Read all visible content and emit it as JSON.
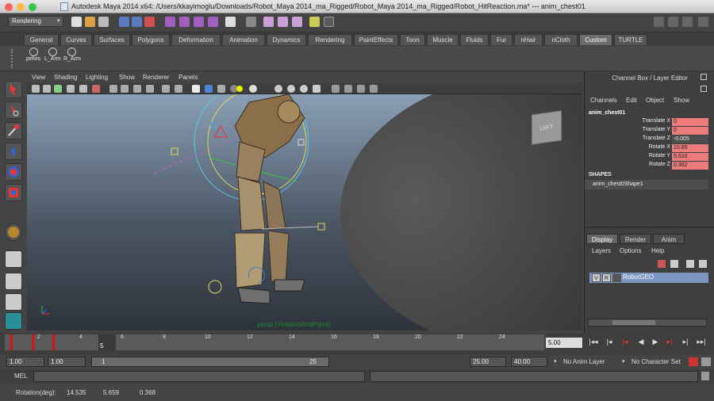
{
  "window": {
    "title": "Autodesk Maya 2014 x64: /Users/kkayimoglu/Downloads/Robot_Maya 2014_ma_Rigged/Robot_Maya 2014_ma_Rigged/Robot_HitReaction.ma*    ---    anim_chest01"
  },
  "status_line": {
    "mode": "Rendering"
  },
  "shelf_tabs": [
    "General",
    "Curves",
    "Surfaces",
    "Polygons",
    "Deformation",
    "Animation",
    "Dynamics",
    "Rendering",
    "PaintEffects",
    "Toon",
    "Muscle",
    "Fluids",
    "Fur",
    "nHair",
    "nCloth",
    "Custom",
    "TURTLE"
  ],
  "active_shelf_tab": "Custom",
  "shelf_buttons": [
    "pelvis",
    "L_Arm",
    "R_Arm"
  ],
  "viewport": {
    "menu": [
      "View",
      "Shading",
      "Lighting",
      "Show",
      "Renderer",
      "Panels"
    ],
    "view_cube": "LEFT",
    "camera_label": "persp (ViewportAndPanel)"
  },
  "channel_box": {
    "title": "Channel Box / Layer Editor",
    "menu": [
      "Channels",
      "Edit",
      "Object",
      "Show"
    ],
    "node": "anim_chest01",
    "attributes": [
      {
        "name": "Translate X",
        "value": "0"
      },
      {
        "name": "Translate Y",
        "value": "0"
      },
      {
        "name": "Translate Z",
        "value": "-0.005"
      },
      {
        "name": "Rotate X",
        "value": "10.85"
      },
      {
        "name": "Rotate Y",
        "value": "5.633"
      },
      {
        "name": "Rotate Z",
        "value": "0.362"
      }
    ],
    "shapes_header": "SHAPES",
    "shape": "anim_chest0Shape1"
  },
  "layer_editor": {
    "tabs": [
      "Display",
      "Render",
      "Anim"
    ],
    "active_tab": "Display",
    "menu": [
      "Layers",
      "Options",
      "Help"
    ],
    "layer": {
      "v": "V",
      "r": "R",
      "name": "RobotGEO"
    }
  },
  "time_slider": {
    "ticks": [
      "2",
      "4",
      "6",
      "8",
      "10",
      "12",
      "14",
      "16",
      "18",
      "20",
      "22",
      "24"
    ],
    "current_frame_marker": "5",
    "current_frame": "5.00"
  },
  "range_slider": {
    "start": "1.00",
    "playback_start": "1.00",
    "bar_start": "1",
    "bar_end": "25",
    "playback_end": "25.00",
    "end": "40.00",
    "anim_layer": "No Anim Layer",
    "character_set": "No Character Set"
  },
  "command_line": {
    "label": "MEL"
  },
  "help_line": {
    "label": "Rotation(deg):",
    "x": "14.535",
    "y": "5.659",
    "z": "0.368"
  },
  "colors": {
    "key": "#dd1111",
    "channel_highlight": "#ec7c7c",
    "layer_selected": "#7a95c0"
  }
}
